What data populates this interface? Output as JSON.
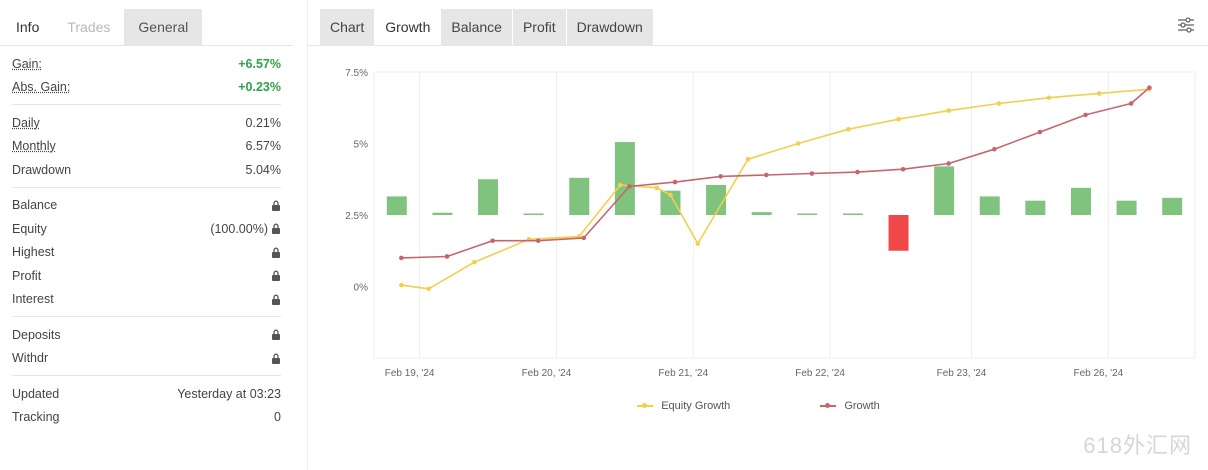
{
  "left": {
    "tabs": [
      {
        "label": "Info"
      },
      {
        "label": "Trades"
      },
      {
        "label": "General"
      }
    ],
    "group1": [
      {
        "key": "Gain:",
        "value": "+6.57%"
      },
      {
        "key": "Abs. Gain:",
        "value": "+0.23%"
      }
    ],
    "group2": [
      {
        "key": "Daily",
        "value": "0.21%"
      },
      {
        "key": "Monthly",
        "value": "6.57%"
      },
      {
        "key": "Drawdown",
        "value": "5.04%"
      }
    ],
    "group3": [
      {
        "key": "Balance",
        "value": ""
      },
      {
        "key": "Equity",
        "value": "(100.00%)"
      },
      {
        "key": "Highest",
        "value": ""
      },
      {
        "key": "Profit",
        "value": ""
      },
      {
        "key": "Interest",
        "value": ""
      }
    ],
    "group4": [
      {
        "key": "Deposits",
        "value": ""
      },
      {
        "key": "Withdr",
        "value": ""
      }
    ],
    "group5": [
      {
        "key": "Updated",
        "value": "Yesterday at 03:23"
      },
      {
        "key": "Tracking",
        "value": "0"
      }
    ]
  },
  "right": {
    "tabs": [
      {
        "label": "Chart"
      },
      {
        "label": "Growth"
      },
      {
        "label": "Balance"
      },
      {
        "label": "Profit"
      },
      {
        "label": "Drawdown"
      }
    ],
    "legend": [
      {
        "label": "Equity Growth",
        "color": "#f2cf4c"
      },
      {
        "label": "Growth",
        "color": "#c9646e"
      }
    ],
    "watermark": "618外汇网"
  },
  "chart_data": {
    "type": "line",
    "x_ticks": [
      "Feb 19, '24",
      "Feb 20, '24",
      "Feb 21, '24",
      "Feb 22, '24",
      "Feb 23, '24",
      "Feb 26, '24"
    ],
    "y_ticks": [
      "7.5%",
      "5%",
      "2.5%",
      "0%"
    ],
    "ylim": [
      -2.5,
      7.5
    ],
    "series": [
      {
        "name": "Equity Growth",
        "color": "#f2cf4c",
        "x": [
          0.6,
          1.2,
          2.2,
          3.4,
          4.5,
          5.4,
          6.2,
          6.5,
          7.1,
          8.2,
          9.3,
          10.4,
          11.5,
          12.6,
          13.7,
          14.8,
          15.9,
          17.0
        ],
        "y": [
          0.05,
          -0.08,
          0.85,
          1.65,
          1.75,
          3.55,
          3.45,
          3.2,
          1.5,
          4.45,
          5.0,
          5.5,
          5.85,
          6.15,
          6.4,
          6.6,
          6.75,
          6.9
        ]
      },
      {
        "name": "Growth",
        "color": "#c9646e",
        "x": [
          0.6,
          1.6,
          2.6,
          3.6,
          4.6,
          5.6,
          6.6,
          7.6,
          8.6,
          9.6,
          10.6,
          11.6,
          12.6,
          13.6,
          14.6,
          15.6,
          16.6,
          17.0
        ],
        "y": [
          1.0,
          1.05,
          1.6,
          1.6,
          1.7,
          3.5,
          3.65,
          3.85,
          3.9,
          3.95,
          4.0,
          4.1,
          4.3,
          4.8,
          5.4,
          6.0,
          6.4,
          6.95
        ]
      }
    ],
    "bars": {
      "x": [
        0.5,
        1.5,
        2.5,
        3.5,
        4.5,
        5.5,
        6.5,
        7.5,
        8.5,
        9.5,
        10.5,
        11.5,
        12.5,
        13.5,
        14.5,
        15.5,
        16.5,
        17.5
      ],
      "values": [
        0.65,
        0.08,
        1.25,
        0.03,
        1.3,
        2.55,
        0.85,
        1.05,
        0.1,
        0.05,
        0.0,
        -1.25,
        1.7,
        0.65,
        0.5,
        0.95,
        0.5,
        0.6
      ],
      "positive_color": "#7fc37f",
      "negative_color": "#f04848"
    }
  }
}
